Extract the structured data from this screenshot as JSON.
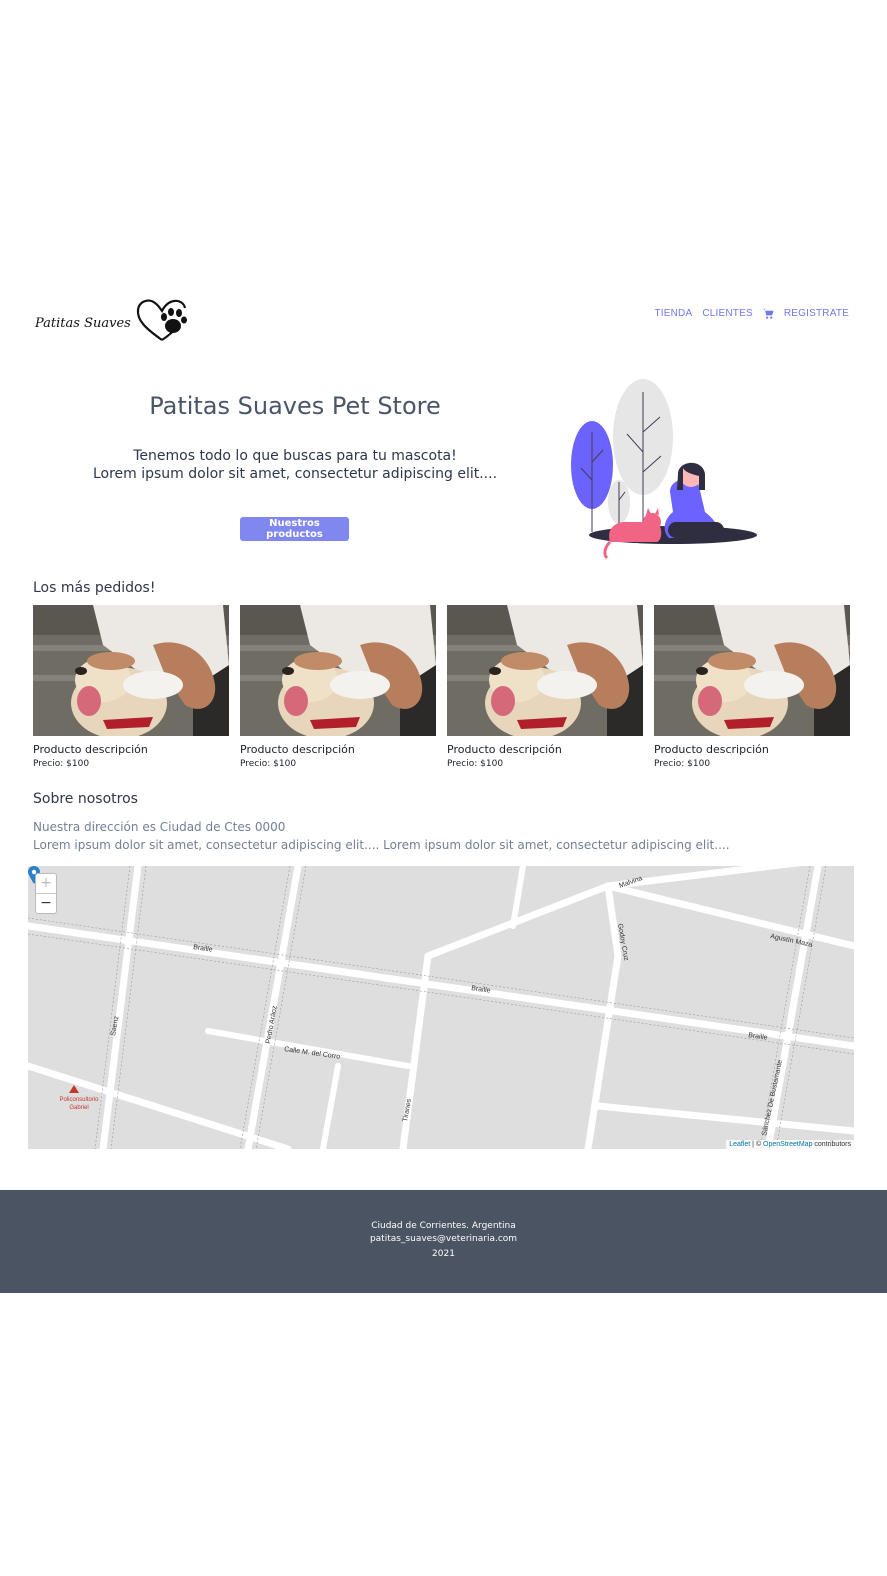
{
  "header": {
    "logo_text": "Patitas Suaves",
    "nav": {
      "store": "TIENDA",
      "clients": "CLIENTES",
      "register": "REGISTRATE"
    }
  },
  "hero": {
    "title": "Patitas Suaves Pet Store",
    "subtitle_line1": "Tenemos todo lo que buscas para tu mascota!",
    "subtitle_line2": "Lorem ipsum dolor sit amet, consectetur adipiscing elit....",
    "button_label": "Nuestros productos"
  },
  "featured": {
    "title": "Los más pedidos!",
    "products": [
      {
        "name": "Producto descripción",
        "price": "Precio: $100"
      },
      {
        "name": "Producto descripción",
        "price": "Precio: $100"
      },
      {
        "name": "Producto descripción",
        "price": "Precio: $100"
      },
      {
        "name": "Producto descripción",
        "price": "Precio: $100"
      }
    ]
  },
  "about": {
    "title": "Sobre nosotros",
    "line1": "Nuestra dirección es Ciudad de Ctes 0000",
    "line2": "Lorem ipsum dolor sit amet, consectetur adipiscing elit.... Lorem ipsum dolor sit amet, consectetur adipiscing elit...."
  },
  "map": {
    "zoom_in": "+",
    "zoom_out": "−",
    "attribution_leaflet": "Leaflet",
    "attribution_sep": " | © ",
    "attribution_osm": "OpenStreetMap",
    "attribution_suffix": " contributors",
    "streets": {
      "braille1": "Braille",
      "braille2": "Braille",
      "braille3": "Braille",
      "malvinas": "Malvina",
      "godoy": "Godoy Cruz",
      "agustin": "Agustín Maza",
      "pedro": "Pedro Aráoz",
      "calle_m": "Calle M. del Corro",
      "saenz": "Saenz",
      "tiranes": "Tiranes",
      "sanchez": "Sánchez De Bustamante",
      "poli": "Policonsultorio",
      "poli2": "Gabriel"
    }
  },
  "footer": {
    "city": "Ciudad de Corrientes. Argentina",
    "email": "patitas_suaves@veterinaria.com",
    "year": "2021"
  },
  "colors": {
    "accent": "#8088f0",
    "footer_bg": "#4a5462",
    "illustration_purple": "#6c63ff",
    "illustration_pink": "#f06584"
  }
}
